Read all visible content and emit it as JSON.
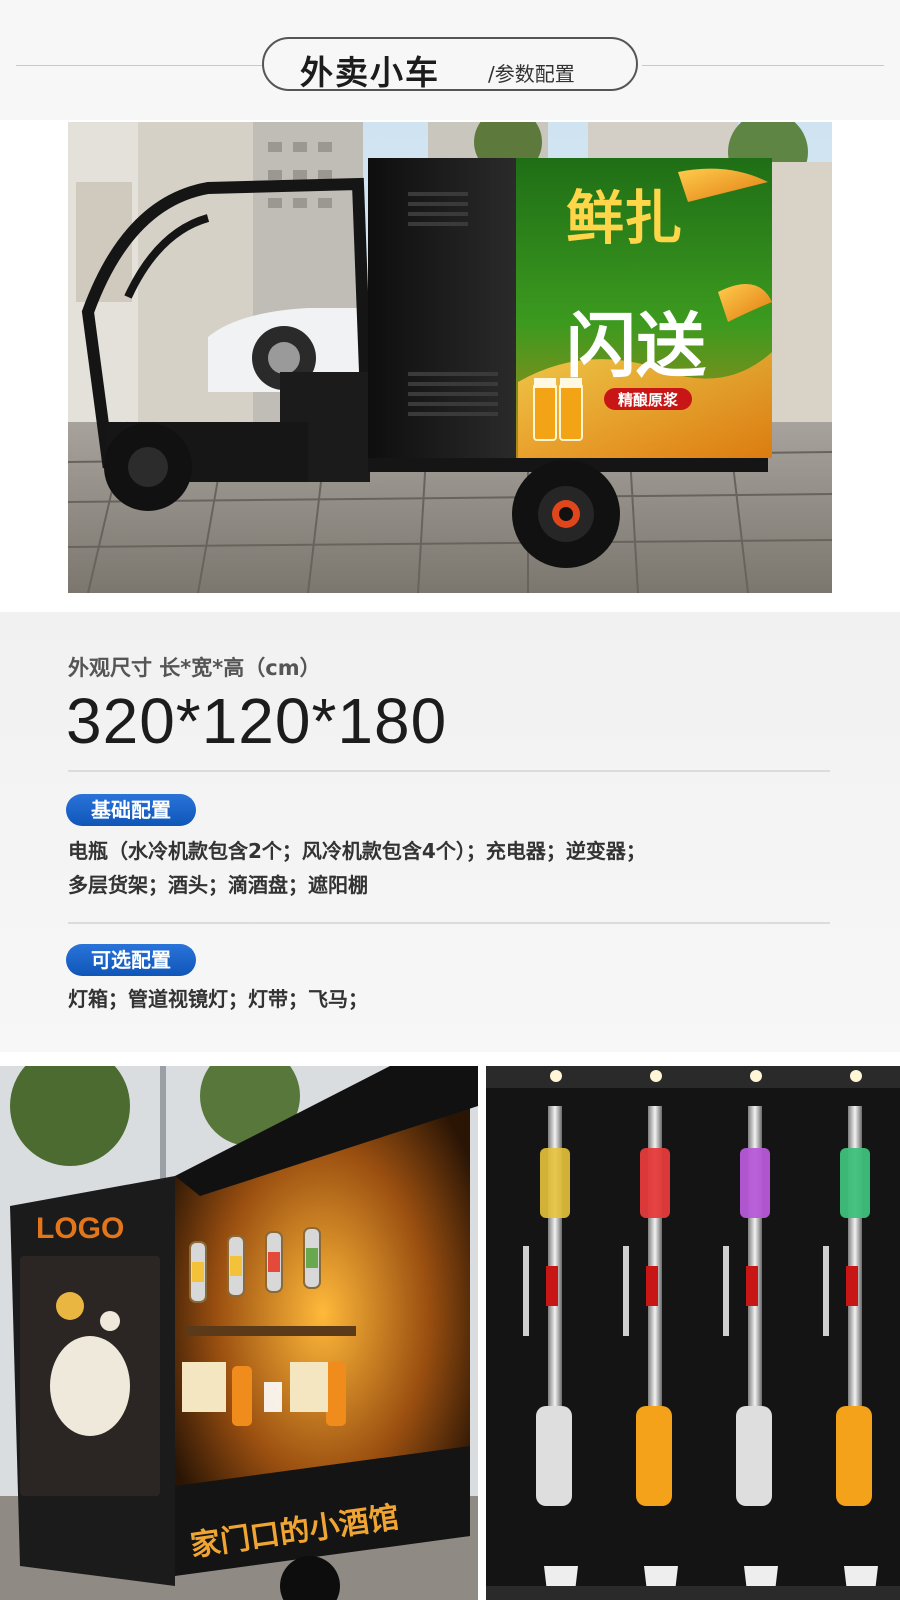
{
  "header": {
    "title": "外卖小车",
    "subtitle": "/参数配置"
  },
  "poster": {
    "line1": "鲜扎",
    "line2": "闪送",
    "tag": "精酿原浆"
  },
  "specs": {
    "dimension_label": "外观尺寸 长*宽*高（cm）",
    "dimension_value": "320*120*180",
    "basic_badge": "基础配置",
    "basic_line1": "电瓶（水冷机款包含2个；风冷机款包含4个）；充电器；逆变器；",
    "basic_line2": "多层货架；酒头；滴酒盘；遮阳棚",
    "optional_badge": "可选配置",
    "optional_text": "灯箱；管道视镜灯；灯带；飞马；"
  },
  "cart_photo": {
    "logo": "LOGO",
    "side_text": "家门口的小酒馆"
  },
  "colors": {
    "badge_blue": "#1565c8",
    "poster_green": "#2f8a1c",
    "beer_amber": "#f0a21b",
    "cart_black": "#1a1a1a"
  }
}
